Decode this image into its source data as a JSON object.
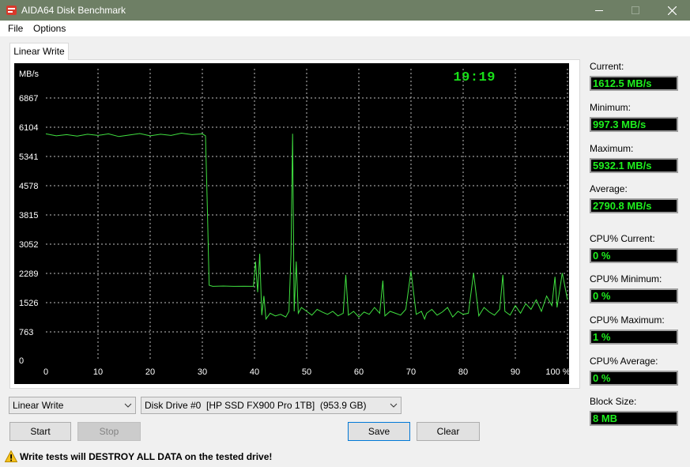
{
  "window": {
    "title": "AIDA64 Disk Benchmark",
    "controls": [
      "minimize",
      "maximize",
      "close"
    ]
  },
  "menu": {
    "items": [
      "File",
      "Options"
    ]
  },
  "tab": {
    "label": "Linear Write"
  },
  "chart_data": {
    "type": "line",
    "clock": "19:19",
    "ylabel": "MB/s",
    "y_ticks": [
      "6867",
      "6104",
      "5341",
      "4578",
      "3815",
      "3052",
      "2289",
      "1526",
      "763",
      "0"
    ],
    "x_ticks": [
      "0",
      "10",
      "20",
      "30",
      "40",
      "50",
      "60",
      "70",
      "80",
      "90",
      "100 %"
    ],
    "xlim": [
      0,
      100
    ],
    "ylim": [
      0,
      7630
    ],
    "grid": true,
    "line_color": "#40e040",
    "series": [
      {
        "x": [
          0,
          2,
          4,
          6,
          8,
          10,
          12,
          14,
          16,
          18,
          20,
          22,
          24,
          26,
          28,
          30,
          30.6,
          31.0,
          31.3,
          32,
          34,
          36,
          38,
          39.8,
          40.2,
          40.6,
          41.0,
          41.4,
          41.8,
          42.2,
          43,
          44,
          45,
          46,
          46.6,
          47.0,
          47.3,
          47.6,
          48.0,
          48.4,
          49,
          50,
          51,
          52,
          53,
          54,
          55,
          56,
          57,
          57.5,
          58,
          59,
          60,
          61,
          62,
          63,
          64,
          64.6,
          65,
          66,
          67,
          68,
          69,
          70,
          71,
          72,
          72.6,
          73,
          74,
          75,
          76,
          77,
          78,
          79,
          80,
          81,
          82,
          83,
          84,
          85,
          86,
          87,
          87.6,
          88,
          89,
          90,
          91,
          92,
          93,
          94,
          95,
          96,
          97,
          97.6,
          98,
          99,
          100
        ],
        "y": [
          5930,
          5880,
          5910,
          5870,
          5920,
          5890,
          5930,
          5860,
          5900,
          5940,
          5880,
          5920,
          5890,
          5950,
          5910,
          5930,
          5880,
          3800,
          1980,
          1950,
          1960,
          1950,
          1955,
          1950,
          2600,
          1800,
          2800,
          1200,
          1700,
          1100,
          1250,
          1180,
          1220,
          1150,
          1300,
          2800,
          5932,
          1300,
          2600,
          1250,
          1400,
          1300,
          1200,
          1350,
          1280,
          1220,
          1300,
          1180,
          1250,
          2250,
          1200,
          1300,
          1150,
          1280,
          1220,
          1400,
          1250,
          2100,
          1180,
          1300,
          1250,
          1200,
          1350,
          2350,
          1220,
          1300,
          1100,
          1250,
          1350,
          1200,
          1280,
          1400,
          1150,
          1300,
          1220,
          1250,
          2300,
          1180,
          1400,
          1280,
          1200,
          1350,
          2250,
          1300,
          1200,
          1450,
          1250,
          1500,
          1350,
          1600,
          1300,
          1700,
          1450,
          2200,
          1400,
          2300,
          1600
        ]
      }
    ]
  },
  "stats": [
    {
      "label": "Current:",
      "value": "1612.5 MB/s"
    },
    {
      "label": "Minimum:",
      "value": "997.3 MB/s"
    },
    {
      "label": "Maximum:",
      "value": "5932.1 MB/s"
    },
    {
      "label": "Average:",
      "value": "2790.8 MB/s"
    },
    {
      "label": "CPU% Current:",
      "value": "0 %"
    },
    {
      "label": "CPU% Minimum:",
      "value": "0 %"
    },
    {
      "label": "CPU% Maximum:",
      "value": "1 %"
    },
    {
      "label": "CPU% Average:",
      "value": "0 %"
    },
    {
      "label": "Block Size:",
      "value": "8 MB"
    }
  ],
  "controls": {
    "test_select": "Linear Write",
    "drive_select": "Disk Drive #0  [HP SSD FX900 Pro 1TB]  (953.9 GB)",
    "start": "Start",
    "stop": "Stop",
    "save": "Save",
    "clear": "Clear"
  },
  "warning": {
    "text": "Write tests will DESTROY ALL DATA on the tested drive!",
    "icon": "warning-icon"
  },
  "colors": {
    "titlebar": "#6e7f65",
    "accent_green": "#1ef01e",
    "chart_bg": "#000000"
  }
}
